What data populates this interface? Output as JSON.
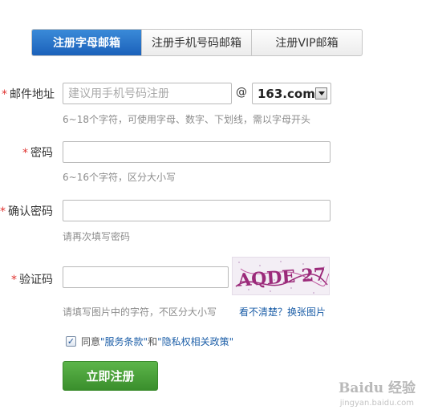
{
  "tabs": [
    {
      "label": "注册字母邮箱",
      "active": true
    },
    {
      "label": "注册手机号码邮箱",
      "active": false
    },
    {
      "label": "注册VIP邮箱",
      "active": false
    }
  ],
  "form": {
    "required_mark": "*",
    "email": {
      "label": "邮件地址",
      "placeholder": "建议用手机号码注册",
      "at": "@",
      "domain": "163.com",
      "hint": "6~18个字符，可使用字母、数字、下划线，需以字母开头"
    },
    "password": {
      "label": "密码",
      "hint": "6~16个字符，区分大小写"
    },
    "confirm_password": {
      "label": "确认密码",
      "hint": "请再次填写密码"
    },
    "captcha": {
      "label": "验证码",
      "image_text": "AQDE 27",
      "hint": "请填写图片中的字符，不区分大小写",
      "refresh_link": "看不清楚？换张图片"
    },
    "agreement": {
      "checked": true,
      "check_mark": "✓",
      "prefix": "同意",
      "terms": "\"服务条款\"",
      "and": "和",
      "privacy": "\"隐私权相关政策\""
    },
    "submit_label": "立即注册"
  },
  "watermark": {
    "brand": "Baidu 经验",
    "url": "jingyan.baidu.com"
  },
  "colors": {
    "tab_active": "#1b61ba",
    "required": "#e0322f",
    "link": "#1d5fa8",
    "submit": "#3a8e2c",
    "captcha_ink": "#9b2a7a"
  }
}
